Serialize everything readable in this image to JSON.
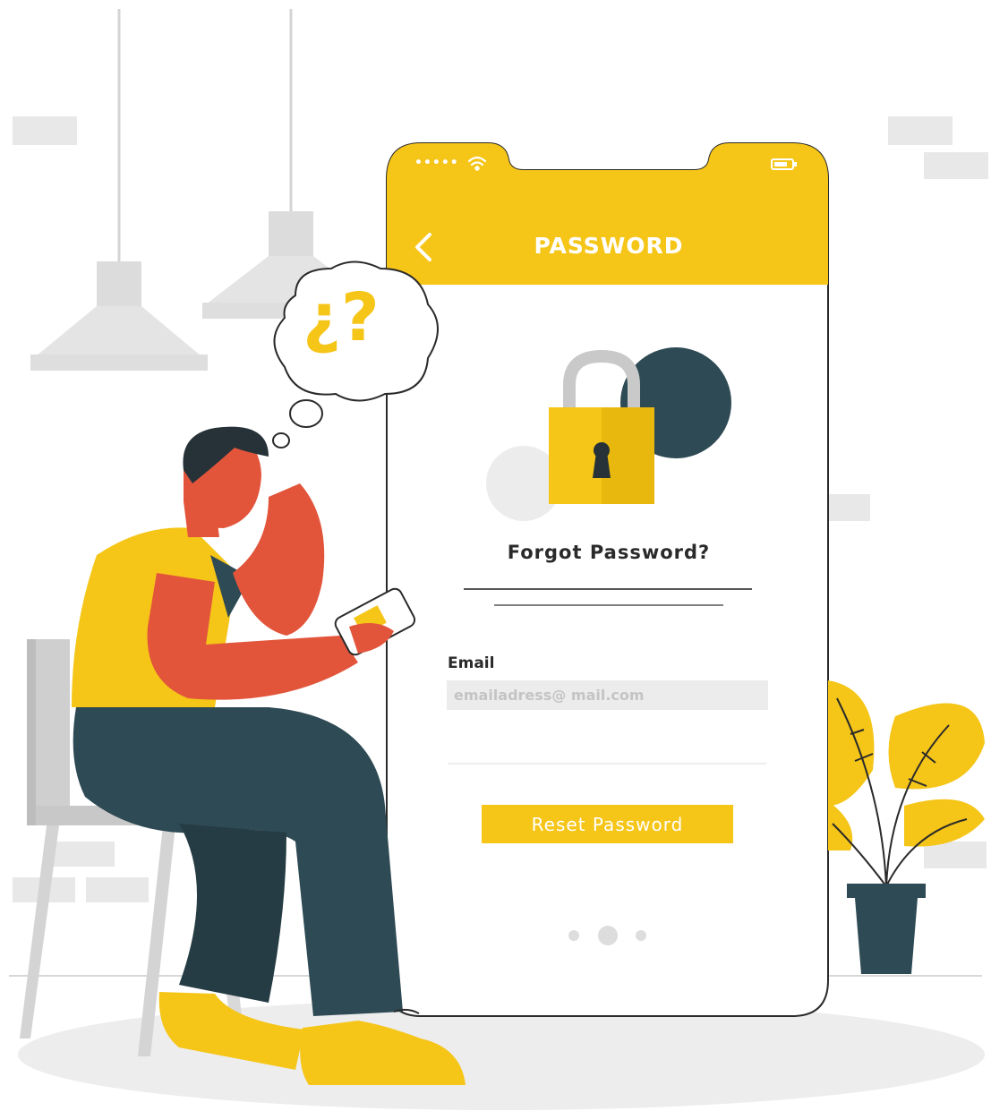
{
  "app": {
    "screen_title": "PASSWORD"
  },
  "status_bar": {
    "signal": "•••••"
  },
  "form": {
    "heading": "Forgot Password?",
    "email_label": "Email",
    "email_placeholder": "emailadress@ mail.com",
    "email_value": "",
    "reset_button_label": "Reset Password"
  },
  "pager": {
    "total": 3,
    "active_index": 1
  },
  "thought_bubble": {
    "text": "¿?"
  },
  "icons": {
    "back": "chevron-left-icon",
    "wifi": "wifi-icon",
    "battery": "battery-icon",
    "lock": "padlock-icon"
  },
  "colors": {
    "accent_yellow": "#f5c518",
    "dark_teal": "#2e4a54",
    "skin": "#e2553b",
    "light_grey": "#e6e6e6"
  }
}
